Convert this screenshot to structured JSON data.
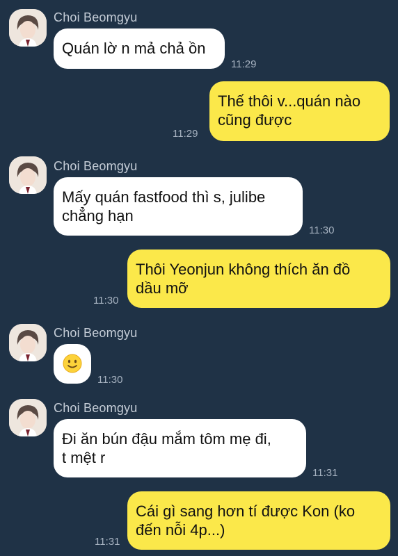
{
  "chat": {
    "contact_name": "Choi Beomgyu",
    "messages": [
      {
        "side": "in",
        "text": "Quán lờ n mả chả ồn",
        "time": "11:29"
      },
      {
        "side": "out",
        "lines": [
          "Thế thôi v...quán nào",
          "cũng được"
        ],
        "time": "11:29"
      },
      {
        "side": "in",
        "lines": [
          "Mấy quán fastfood thì s, julibe",
          "chẳng hạn"
        ],
        "time": "11:30"
      },
      {
        "side": "out",
        "lines": [
          "Thôi Yeonjun không thích ăn đồ",
          "dầu mỡ"
        ],
        "time": "11:30"
      },
      {
        "side": "in",
        "emoji": "slightly-smiling-face-icon",
        "time": "11:30"
      },
      {
        "side": "in",
        "lines": [
          "Đi ăn bún đậu mắm tôm mẹ đi,",
          "t mệt r"
        ],
        "time": "11:31"
      },
      {
        "side": "out",
        "lines": [
          "Cái gì sang hơn tí được Kon (ko",
          "đến nỗi 4p...)"
        ],
        "time": "11:31"
      }
    ]
  },
  "colors": {
    "background": "#1f3246",
    "incoming_bubble": "#ffffff",
    "outgoing_bubble": "#fbe84a",
    "timestamp": "#a6b2c0",
    "sender_name": "#c4ccd6"
  }
}
